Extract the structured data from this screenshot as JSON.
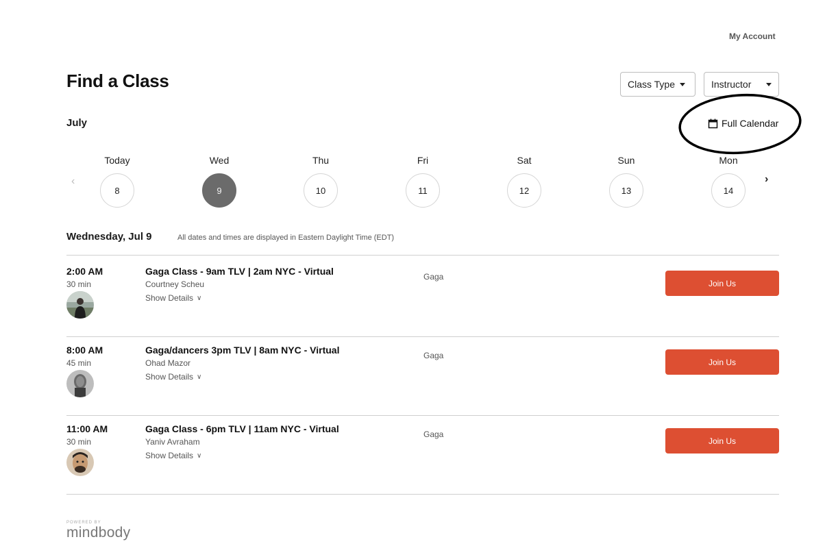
{
  "header": {
    "my_account": "My Account",
    "title": "Find a Class",
    "filters": {
      "class_type": "Class Type",
      "instructor": "Instructor"
    },
    "full_calendar": "Full Calendar",
    "month": "July"
  },
  "week": [
    {
      "label": "Today",
      "num": "8",
      "selected": false
    },
    {
      "label": "Wed",
      "num": "9",
      "selected": true
    },
    {
      "label": "Thu",
      "num": "10",
      "selected": false
    },
    {
      "label": "Fri",
      "num": "11",
      "selected": false
    },
    {
      "label": "Sat",
      "num": "12",
      "selected": false
    },
    {
      "label": "Sun",
      "num": "13",
      "selected": false
    },
    {
      "label": "Mon",
      "num": "14",
      "selected": false
    }
  ],
  "schedule": {
    "date_heading": "Wednesday, Jul 9",
    "tz_note": "All dates and times are displayed in Eastern Daylight Time (EDT)",
    "classes": [
      {
        "time": "2:00 AM",
        "duration": "30 min",
        "title": "Gaga Class - 9am TLV | 2am NYC - Virtual",
        "instructor": "Courtney Scheu",
        "details": "Show Details",
        "category": "Gaga",
        "cta": "Join Us"
      },
      {
        "time": "8:00 AM",
        "duration": "45 min",
        "title": "Gaga/dancers 3pm TLV | 8am NYC - Virtual",
        "instructor": "Ohad Mazor",
        "details": "Show Details",
        "category": "Gaga",
        "cta": "Join Us"
      },
      {
        "time": "11:00 AM",
        "duration": "30 min",
        "title": "Gaga Class - 6pm TLV | 11am NYC - Virtual",
        "instructor": "Yaniv Avraham",
        "details": "Show Details",
        "category": "Gaga",
        "cta": "Join Us"
      }
    ]
  },
  "footer": {
    "powered_by": "POWERED BY",
    "logo": "mindbody"
  },
  "colors": {
    "accent": "#dd4f32",
    "selected_day": "#6b6b6b",
    "annotation": "#000000"
  }
}
